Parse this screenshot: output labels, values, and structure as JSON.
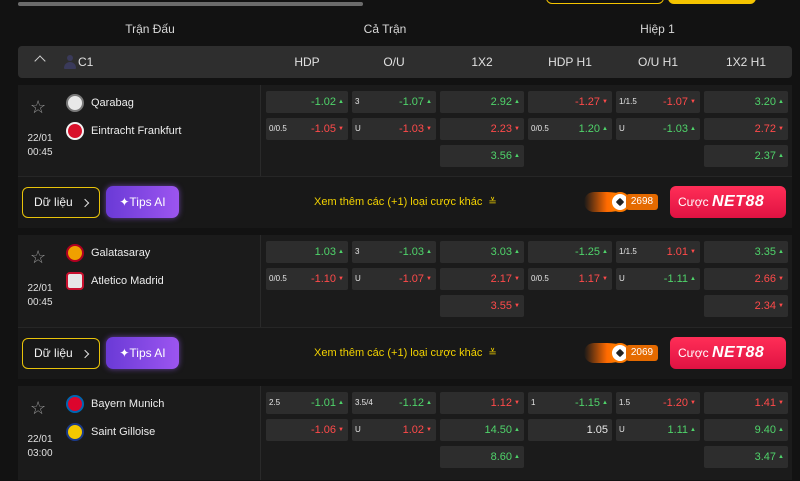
{
  "header": {
    "col_match": "Trận Đấu",
    "col_full": "Cả Trận",
    "col_half": "Hiệp 1"
  },
  "league": {
    "name": "C1",
    "columns": [
      "HDP",
      "O/U",
      "1X2",
      "HDP H1",
      "O/U H1",
      "1X2 H1"
    ]
  },
  "matches": [
    {
      "date": "22/01",
      "time": "00:45",
      "home": "Qarabag",
      "away": "Eintracht Frankfurt",
      "hdp": {
        "home_line": "",
        "home": "-1.02",
        "away_line": "0/0.5",
        "away": "-1.05"
      },
      "ou": {
        "home_line": "3",
        "home": "-1.07",
        "away_line": "U",
        "away": "-1.03"
      },
      "x12": {
        "home": "2.92",
        "away": "2.23",
        "draw": "3.56"
      },
      "hdp_h1": {
        "home_line": "",
        "home": "-1.27",
        "away_line": "0/0.5",
        "away": "1.20"
      },
      "ou_h1": {
        "home_line": "1/1.5",
        "home": "-1.07",
        "away_line": "U",
        "away": "-1.03"
      },
      "x12_h1": {
        "home": "3.20",
        "away": "2.72",
        "draw": "2.37"
      }
    },
    {
      "date": "22/01",
      "time": "00:45",
      "home": "Galatasaray",
      "away": "Atletico Madrid",
      "hdp": {
        "home_line": "",
        "home": "1.03",
        "away_line": "0/0.5",
        "away": "-1.10"
      },
      "ou": {
        "home_line": "3",
        "home": "-1.03",
        "away_line": "U",
        "away": "-1.07"
      },
      "x12": {
        "home": "3.03",
        "away": "2.17",
        "draw": "3.55"
      },
      "hdp_h1": {
        "home_line": "",
        "home": "-1.25",
        "away_line": "0/0.5",
        "away": "1.17"
      },
      "ou_h1": {
        "home_line": "1/1.5",
        "home": "1.01",
        "away_line": "U",
        "away": "-1.11"
      },
      "x12_h1": {
        "home": "3.35",
        "away": "2.66",
        "draw": "2.34"
      }
    },
    {
      "date": "22/01",
      "time": "03:00",
      "home": "Bayern Munich",
      "away": "Saint Gilloise",
      "hdp": {
        "home_line": "2.5",
        "home": "-1.01",
        "away_line": "",
        "away": "-1.06"
      },
      "ou": {
        "home_line": "3.5/4",
        "home": "-1.12",
        "away_line": "U",
        "away": "1.02"
      },
      "x12": {
        "home": "1.12",
        "away": "14.50",
        "draw": "8.60"
      },
      "hdp_h1": {
        "home_line": "1",
        "home": "-1.15",
        "away_line": "",
        "away": "1.05"
      },
      "ou_h1": {
        "home_line": "1.5",
        "home": "-1.20",
        "away_line": "U",
        "away": "1.11"
      },
      "x12_h1": {
        "home": "1.41",
        "away": "9.40",
        "draw": "3.47"
      }
    }
  ],
  "actions": [
    {
      "data_label": "Dữ liệu",
      "tips_label": "✦Tips AI",
      "more_label": "Xem thêm các (+1) loại cược khác",
      "more_icon": "≚",
      "fire_count": "2698",
      "bet_label": "Cược",
      "bet_brand": "NET88"
    },
    {
      "data_label": "Dữ liệu",
      "tips_label": "✦Tips AI",
      "more_label": "Xem thêm các (+1) loại cược khác",
      "more_icon": "≚",
      "fire_count": "2069",
      "bet_label": "Cược",
      "bet_brand": "NET88"
    }
  ],
  "colors": {
    "up": "#4fd36a",
    "down": "#ff4a4a",
    "accent": "#f2d200",
    "bet": "#ff2e57",
    "tips": "#9c55f0"
  }
}
